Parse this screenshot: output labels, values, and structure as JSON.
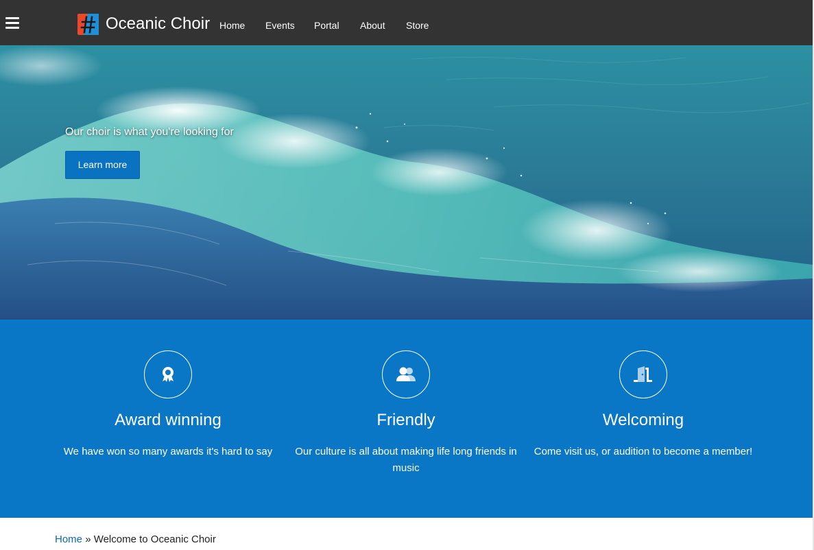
{
  "header": {
    "site_title": "Oceanic Choir",
    "menu_icon": "hamburger-menu-icon",
    "logo_icon": "hash-logo-icon",
    "nav": [
      {
        "label": "Home"
      },
      {
        "label": "Events"
      },
      {
        "label": "Portal"
      },
      {
        "label": "About"
      },
      {
        "label": "Store"
      }
    ]
  },
  "hero": {
    "tagline": "Our choir is what you're looking for",
    "button_label": "Learn more"
  },
  "features": [
    {
      "icon": "award-ribbon-icon",
      "title": "Award winning",
      "text": "We have won so many awards it's hard to say"
    },
    {
      "icon": "users-icon",
      "title": "Friendly",
      "text": "Our culture is all about making life long friends in music"
    },
    {
      "icon": "door-open-icon",
      "title": "Welcoming",
      "text": "Come visit us, or audition to become a member!"
    }
  ],
  "breadcrumb": {
    "home_label": "Home",
    "separator": "»",
    "current": "Welcome to Oceanic Choir"
  },
  "colors": {
    "topbar": "#333333",
    "brand_blue": "#0a77c6",
    "button_blue": "#0a73c1",
    "link_blue": "#0a6ab6"
  }
}
